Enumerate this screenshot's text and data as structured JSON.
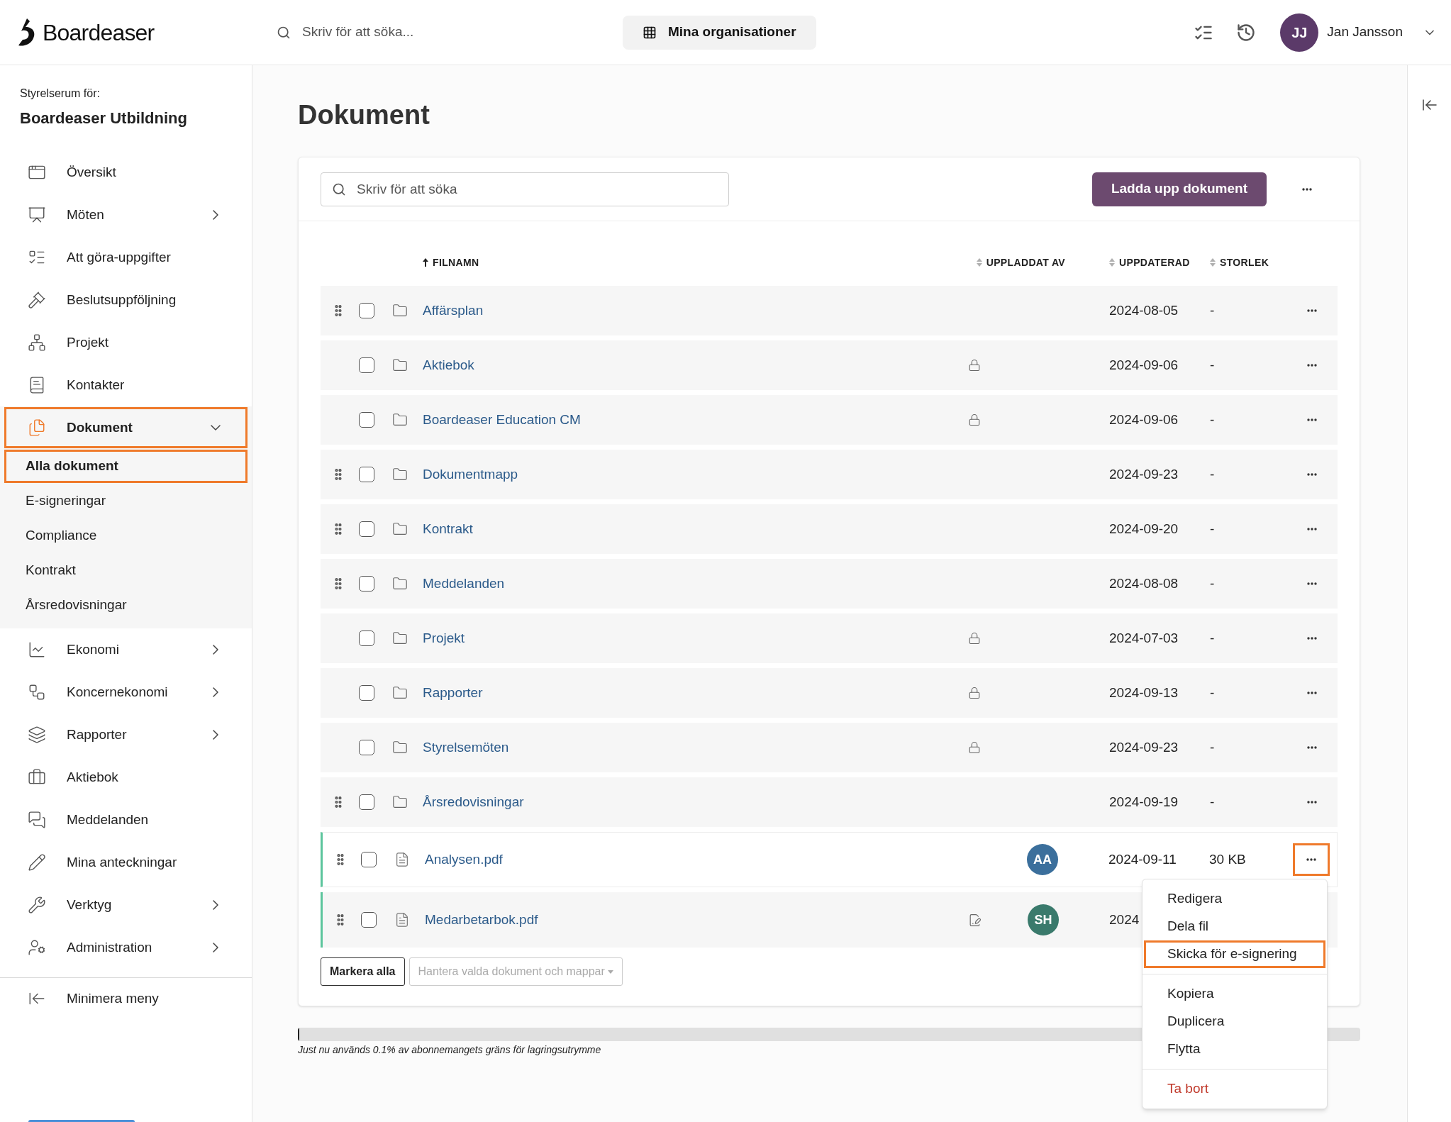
{
  "header": {
    "logo": "Boardeaser",
    "search": {
      "placeholder": "Skriv för att söka..."
    },
    "org_button": "Mina organisationer",
    "user": {
      "initials": "JJ",
      "name": "Jan Jansson"
    }
  },
  "sidebar": {
    "caption": "Styrelserum för:",
    "org": "Boardeaser Utbildning",
    "items": [
      {
        "label": "Översikt",
        "expandable": false,
        "selected": false,
        "highlighted": false
      },
      {
        "label": "Möten",
        "expandable": true,
        "expanded": false,
        "selected": false,
        "highlighted": false
      },
      {
        "label": "Att göra-uppgifter",
        "expandable": false,
        "selected": false,
        "highlighted": false
      },
      {
        "label": "Beslutsuppföljning",
        "expandable": false,
        "selected": false,
        "highlighted": false
      },
      {
        "label": "Projekt",
        "expandable": false,
        "selected": false,
        "highlighted": false
      },
      {
        "label": "Kontakter",
        "expandable": false,
        "selected": false,
        "highlighted": false
      },
      {
        "label": "Dokument",
        "expandable": true,
        "expanded": true,
        "selected": true,
        "highlighted": true,
        "children": [
          {
            "label": "Alla dokument",
            "selected": true,
            "highlighted": true
          },
          {
            "label": "E-signeringar",
            "selected": false,
            "highlighted": false
          },
          {
            "label": "Compliance",
            "selected": false,
            "highlighted": false
          },
          {
            "label": "Kontrakt",
            "selected": false,
            "highlighted": false
          },
          {
            "label": "Årsredovisningar",
            "selected": false,
            "highlighted": false
          }
        ]
      },
      {
        "label": "Ekonomi",
        "expandable": true,
        "expanded": false,
        "selected": false,
        "highlighted": false
      },
      {
        "label": "Koncernekonomi",
        "expandable": true,
        "expanded": false,
        "selected": false,
        "highlighted": false
      },
      {
        "label": "Rapporter",
        "expandable": true,
        "expanded": false,
        "selected": false,
        "highlighted": false
      },
      {
        "label": "Aktiebok",
        "expandable": false,
        "selected": false,
        "highlighted": false
      },
      {
        "label": "Meddelanden",
        "expandable": false,
        "selected": false,
        "highlighted": false
      },
      {
        "label": "Mina anteckningar",
        "expandable": false,
        "selected": false,
        "highlighted": false
      },
      {
        "label": "Verktyg",
        "expandable": true,
        "expanded": false,
        "selected": false,
        "highlighted": false
      },
      {
        "label": "Administration",
        "expandable": true,
        "expanded": false,
        "selected": false,
        "highlighted": false
      }
    ],
    "collapse": "Minimera meny"
  },
  "page": {
    "title": "Dokument",
    "search": {
      "placeholder": "Skriv för att söka"
    },
    "upload_button": "Ladda upp dokument",
    "columns": [
      {
        "label": "FILNAMN",
        "sorted": true
      },
      {
        "label": "UPPLADDAT AV",
        "sorted": false
      },
      {
        "label": "UPPDATERAD",
        "sorted": false
      },
      {
        "label": "STORLEK",
        "sorted": false
      }
    ],
    "rows": [
      {
        "name": "Affärsplan",
        "kind": "folder",
        "draggable": true,
        "locked": false,
        "signed": false,
        "active": false,
        "more_button": true,
        "more_highlighted": false,
        "date": "2024-08-05",
        "size": "-"
      },
      {
        "name": "Aktiebok",
        "kind": "folder",
        "draggable": false,
        "locked": true,
        "signed": false,
        "active": false,
        "more_button": true,
        "more_highlighted": false,
        "date": "2024-09-06",
        "size": "-"
      },
      {
        "name": "Boardeaser Education CM",
        "kind": "folder",
        "draggable": false,
        "locked": true,
        "signed": false,
        "active": false,
        "more_button": true,
        "more_highlighted": false,
        "date": "2024-09-06",
        "size": "-"
      },
      {
        "name": "Dokumentmapp",
        "kind": "folder",
        "draggable": true,
        "locked": false,
        "signed": false,
        "active": false,
        "more_button": true,
        "more_highlighted": false,
        "date": "2024-09-23",
        "size": "-"
      },
      {
        "name": "Kontrakt",
        "kind": "folder",
        "draggable": true,
        "locked": false,
        "signed": false,
        "active": false,
        "more_button": true,
        "more_highlighted": false,
        "date": "2024-09-20",
        "size": "-"
      },
      {
        "name": "Meddelanden",
        "kind": "folder",
        "draggable": true,
        "locked": false,
        "signed": false,
        "active": false,
        "more_button": true,
        "more_highlighted": false,
        "date": "2024-08-08",
        "size": "-"
      },
      {
        "name": "Projekt",
        "kind": "folder",
        "draggable": false,
        "locked": true,
        "signed": false,
        "active": false,
        "more_button": true,
        "more_highlighted": false,
        "date": "2024-07-03",
        "size": "-"
      },
      {
        "name": "Rapporter",
        "kind": "folder",
        "draggable": false,
        "locked": true,
        "signed": false,
        "active": false,
        "more_button": true,
        "more_highlighted": false,
        "date": "2024-09-13",
        "size": "-"
      },
      {
        "name": "Styrelsemöten",
        "kind": "folder",
        "draggable": false,
        "locked": true,
        "signed": false,
        "active": false,
        "more_button": true,
        "more_highlighted": false,
        "date": "2024-09-23",
        "size": "-"
      },
      {
        "name": "Årsredovisningar",
        "kind": "folder",
        "draggable": true,
        "locked": false,
        "signed": false,
        "active": false,
        "more_button": true,
        "more_highlighted": false,
        "date": "2024-09-19",
        "size": "-"
      },
      {
        "name": "Analysen.pdf",
        "kind": "pdf",
        "draggable": true,
        "locked": false,
        "signed": false,
        "active": true,
        "more_button": true,
        "more_highlighted": true,
        "uploader": {
          "initials": "AA",
          "color": "#3b6f9c"
        },
        "date": "2024-09-11",
        "size": "30 KB",
        "menu": {
          "groups": [
            [
              {
                "label": "Redigera",
                "kind": "normal",
                "highlighted": false
              },
              {
                "label": "Dela fil",
                "kind": "normal",
                "highlighted": false
              },
              {
                "label": "Skicka för e-signering",
                "kind": "normal",
                "highlighted": true
              }
            ],
            [
              {
                "label": "Kopiera",
                "kind": "normal",
                "highlighted": false
              },
              {
                "label": "Duplicera",
                "kind": "normal",
                "highlighted": false
              },
              {
                "label": "Flytta",
                "kind": "normal",
                "highlighted": false
              }
            ],
            [
              {
                "label": "Ta bort",
                "kind": "danger",
                "highlighted": false
              }
            ]
          ]
        }
      },
      {
        "name": "Medarbetarbok.pdf",
        "kind": "pdf",
        "draggable": true,
        "locked": false,
        "signed": true,
        "active": false,
        "more_button": false,
        "uploader": {
          "initials": "SH",
          "color": "#3a7a6c"
        },
        "date": "2024"
      }
    ],
    "select_all": "Markera alla",
    "bulk_menu": "Hantera valda dokument och mappar",
    "storage": {
      "level": 0.001,
      "caption": "Just nu används 0.1% av abonnemangets gräns för lagringsutrymme"
    }
  }
}
